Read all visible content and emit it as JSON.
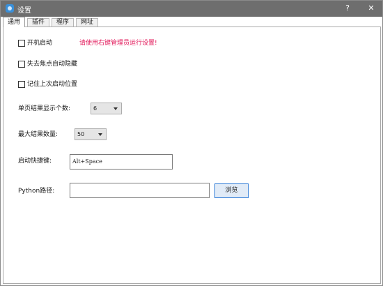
{
  "window": {
    "title": "设置",
    "help_glyph": "?",
    "close_glyph": "✕",
    "accent": "#3a8fd8"
  },
  "tabs": [
    {
      "label": "通用",
      "active": true
    },
    {
      "label": "插件",
      "active": false
    },
    {
      "label": "程序",
      "active": false
    },
    {
      "label": "网址",
      "active": false
    }
  ],
  "general": {
    "checkboxes": [
      {
        "label": "开机启动",
        "checked": false
      },
      {
        "label": "失去焦点自动隐藏",
        "checked": false
      },
      {
        "label": "记住上次启动位置",
        "checked": false
      }
    ],
    "admin_warning": "请使用右键管理员运行设置!",
    "warning_color": "#e2185a",
    "results_per_page": {
      "label": "单页结果显示个数:",
      "value": "6"
    },
    "max_results": {
      "label": "最大结果数量:",
      "value": "50"
    },
    "hotkey": {
      "label": "启动快捷键:",
      "value": "Alt+Space"
    },
    "python_path": {
      "label": "Python路径:",
      "value": "",
      "browse_label": "浏览"
    }
  }
}
